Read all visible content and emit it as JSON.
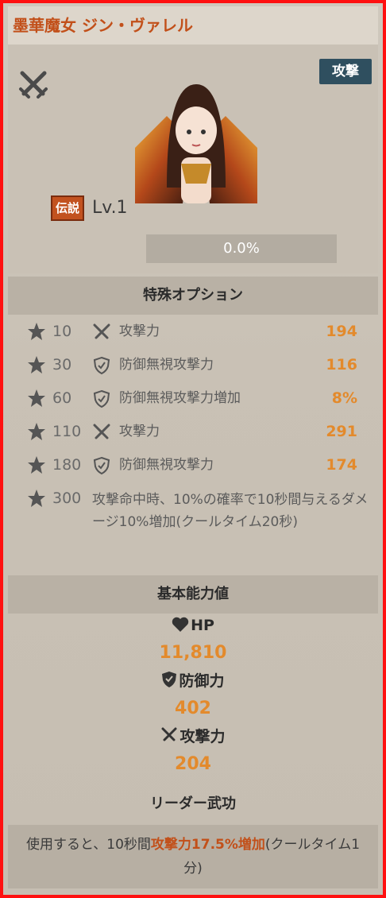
{
  "title": "墨華魔女 ジン・ヴァレル",
  "type_badge": "攻撃",
  "rarity_badge": "伝説",
  "level": "Lv.1",
  "exp_percent": "0.0%",
  "exp_fraction": 0.0,
  "special_options": {
    "heading": "特殊オプション",
    "rows": [
      {
        "star": "10",
        "icon": "swords-icon",
        "name": "攻撃力",
        "value": "194"
      },
      {
        "star": "30",
        "icon": "shield-icon",
        "name": "防御無視攻撃力",
        "value": "116"
      },
      {
        "star": "60",
        "icon": "shield-icon",
        "name": "防御無視攻撃力増加",
        "value": "8%"
      },
      {
        "star": "110",
        "icon": "swords-icon",
        "name": "攻撃力",
        "value": "291"
      },
      {
        "star": "180",
        "icon": "shield-icon",
        "name": "防御無視攻撃力",
        "value": "174"
      }
    ],
    "last": {
      "star": "300",
      "desc": "攻撃命中時、10%の確率で10秒間与えるダメージ10%増加(クールタイム20秒)"
    }
  },
  "base_stats": {
    "heading": "基本能力値",
    "hp_label": "HP",
    "hp_value": "11,810",
    "def_label": "防御力",
    "def_value": "402",
    "atk_label": "攻撃力",
    "atk_value": "204"
  },
  "leader": {
    "heading": "リーダー武功",
    "text_before": "使用すると、10秒間",
    "highlight": "攻撃力17.5%増加",
    "text_after": "(クールタイム1分)"
  },
  "colors": {
    "accent": "#c2501a",
    "value": "#e38a2c",
    "badge_bg": "#2f4f5f",
    "frame": "#ff1010"
  }
}
